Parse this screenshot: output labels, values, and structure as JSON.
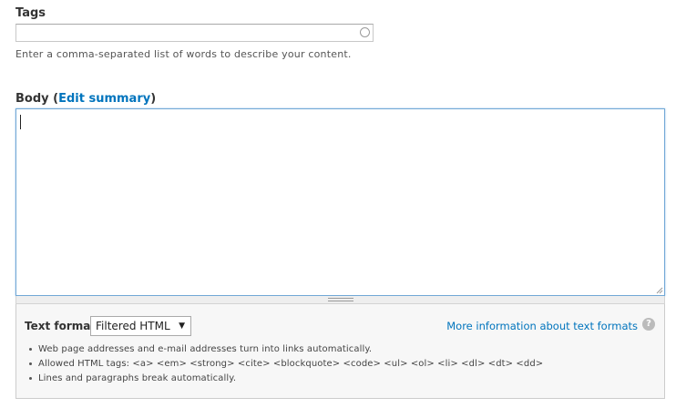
{
  "tags": {
    "label": "Tags",
    "value": "",
    "description": "Enter a comma-separated list of words to describe your content."
  },
  "body": {
    "label_prefix": "Body (",
    "edit_summary_link": "Edit summary",
    "label_suffix": ")",
    "value": ""
  },
  "text_format": {
    "label": "Text format",
    "selected": "Filtered HTML",
    "more_info_link": "More information about text formats",
    "help_icon": "?",
    "tips": [
      "Web page addresses and e-mail addresses turn into links automatically.",
      "Allowed HTML tags: <a> <em> <strong> <cite> <blockquote> <code> <ul> <ol> <li> <dl> <dt> <dd>",
      "Lines and paragraphs break automatically."
    ]
  },
  "colors": {
    "link": "#0074bd",
    "focus_border": "#71a8d6"
  }
}
